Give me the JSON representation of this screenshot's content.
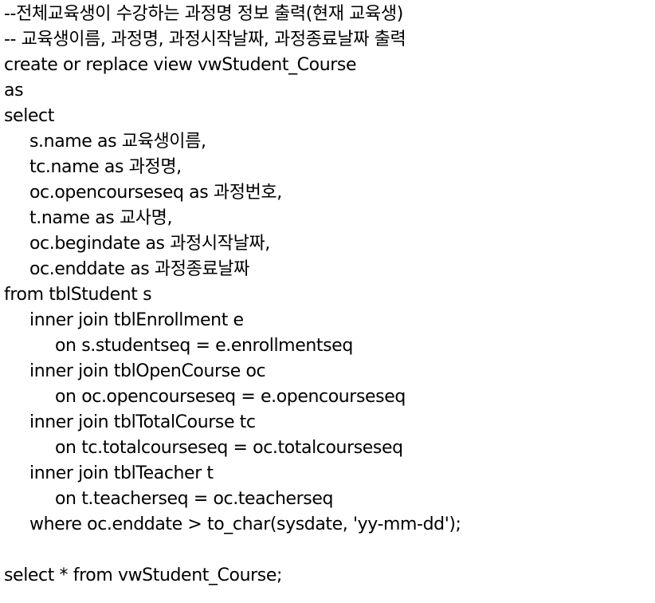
{
  "lines": [
    {
      "indent": 0,
      "text": "--전체교육생이 수강하는 과정명 정보 출력(현재 교육생)"
    },
    {
      "indent": 0,
      "text": "-- 교육생이름, 과정명, 과정시작날짜, 과정종료날짜 출력"
    },
    {
      "indent": 0,
      "text": "create or replace view vwStudent_Course"
    },
    {
      "indent": 0,
      "text": "as"
    },
    {
      "indent": 0,
      "text": "select"
    },
    {
      "indent": 1,
      "text": "s.name as 교육생이름,"
    },
    {
      "indent": 1,
      "text": "tc.name as 과정명,"
    },
    {
      "indent": 1,
      "text": "oc.opencourseseq as 과정번호,"
    },
    {
      "indent": 1,
      "text": "t.name as 교사명,"
    },
    {
      "indent": 1,
      "text": "oc.begindate as 과정시작날짜,"
    },
    {
      "indent": 1,
      "text": "oc.enddate as 과정종료날짜"
    },
    {
      "indent": 0,
      "text": "from tblStudent s"
    },
    {
      "indent": 1,
      "text": "inner join tblEnrollment e"
    },
    {
      "indent": 2,
      "text": "on s.studentseq = e.enrollmentseq"
    },
    {
      "indent": 1,
      "text": "inner join tblOpenCourse oc"
    },
    {
      "indent": 2,
      "text": "on oc.opencourseseq = e.opencourseseq"
    },
    {
      "indent": 1,
      "text": "inner join tblTotalCourse tc"
    },
    {
      "indent": 2,
      "text": "on tc.totalcourseseq = oc.totalcourseseq"
    },
    {
      "indent": 1,
      "text": "inner join tblTeacher t"
    },
    {
      "indent": 2,
      "text": "on t.teacherseq = oc.teacherseq"
    },
    {
      "indent": 1,
      "text": "where oc.enddate > to_char(sysdate, 'yy-mm-dd');"
    },
    {
      "indent": 0,
      "text": ""
    },
    {
      "indent": 0,
      "text": "select * from vwStudent_Course;"
    }
  ]
}
